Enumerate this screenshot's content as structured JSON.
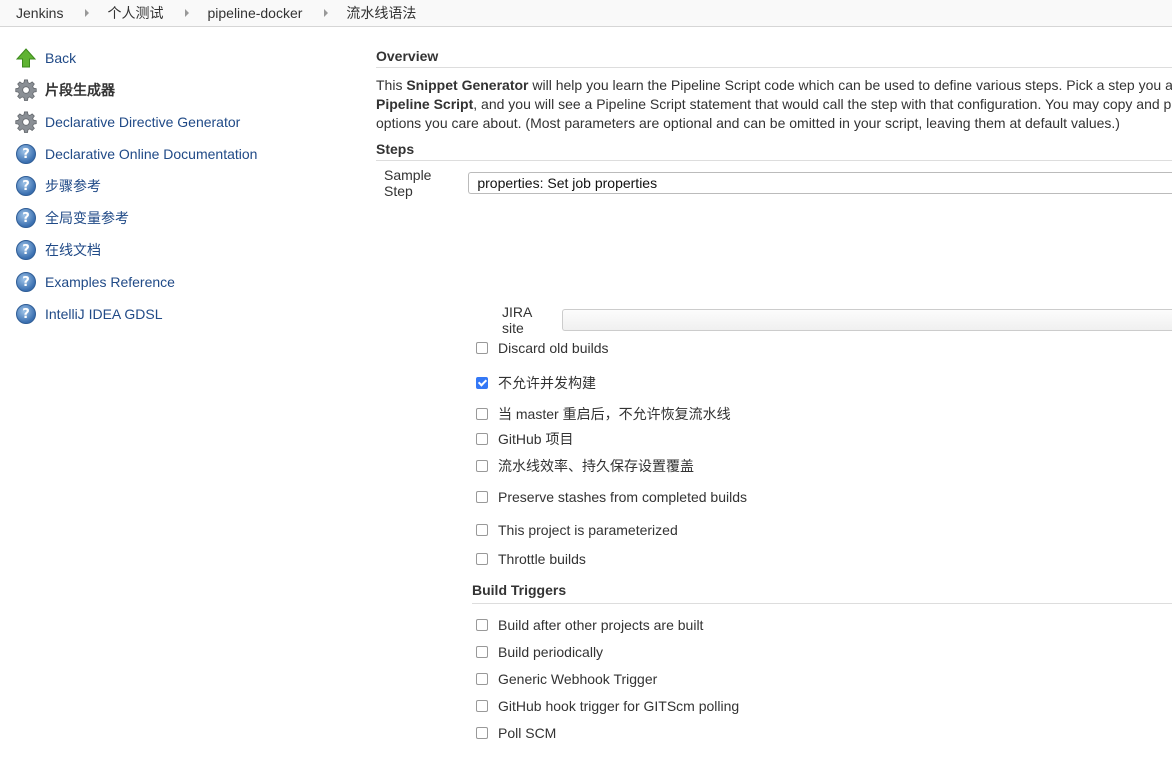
{
  "breadcrumb": [
    "Jenkins",
    "个人测试",
    "pipeline-docker",
    "流水线语法"
  ],
  "sidebar": {
    "items": [
      {
        "label": "Back",
        "icon": "up-arrow-icon"
      },
      {
        "label": "片段生成器",
        "icon": "gear-icon"
      },
      {
        "label": "Declarative Directive Generator",
        "icon": "gear-icon"
      },
      {
        "label": "Declarative Online Documentation",
        "icon": "help-icon"
      },
      {
        "label": "步骤参考",
        "icon": "help-icon"
      },
      {
        "label": "全局变量参考",
        "icon": "help-icon"
      },
      {
        "label": "在线文档",
        "icon": "help-icon"
      },
      {
        "label": "Examples Reference",
        "icon": "help-icon"
      },
      {
        "label": "IntelliJ IDEA GDSL",
        "icon": "help-icon"
      }
    ]
  },
  "overview": {
    "heading": "Overview",
    "line1_pre": "This ",
    "line1_bold": "Snippet Generator",
    "line1_post": " will help you learn the Pipeline Script code which can be used to define various steps. Pick a step you a",
    "line2_bold": "Pipeline Script",
    "line2_post": ", and you will see a Pipeline Script statement that would call the step with that configuration. You may copy and p",
    "line3": "options you care about. (Most parameters are optional and can be omitted in your script, leaving them at default values.)"
  },
  "steps": {
    "heading": "Steps",
    "sample_label": "Sample Step",
    "sample_value": "properties: Set job properties",
    "jira_label": "JIRA site",
    "options": [
      {
        "label": "Discard old builds",
        "checked": false
      },
      {
        "label": "不允许并发构建",
        "checked": true
      },
      {
        "label": "当 master 重启后，不允许恢复流水线",
        "checked": false
      },
      {
        "label": "GitHub 项目",
        "checked": false
      },
      {
        "label": "流水线效率、持久保存设置覆盖",
        "checked": false
      },
      {
        "label": "Preserve stashes from completed builds",
        "checked": false
      },
      {
        "label": "This project is parameterized",
        "checked": false
      },
      {
        "label": "Throttle builds",
        "checked": false
      }
    ]
  },
  "build_triggers": {
    "heading": "Build Triggers",
    "options": [
      {
        "label": "Build after other projects are built",
        "checked": false
      },
      {
        "label": "Build periodically",
        "checked": false
      },
      {
        "label": "Generic Webhook Trigger",
        "checked": false
      },
      {
        "label": "GitHub hook trigger for GITScm polling",
        "checked": false
      },
      {
        "label": "Poll SCM",
        "checked": false
      }
    ]
  },
  "colors": {
    "link": "#204a87",
    "check": "#3478f6"
  }
}
